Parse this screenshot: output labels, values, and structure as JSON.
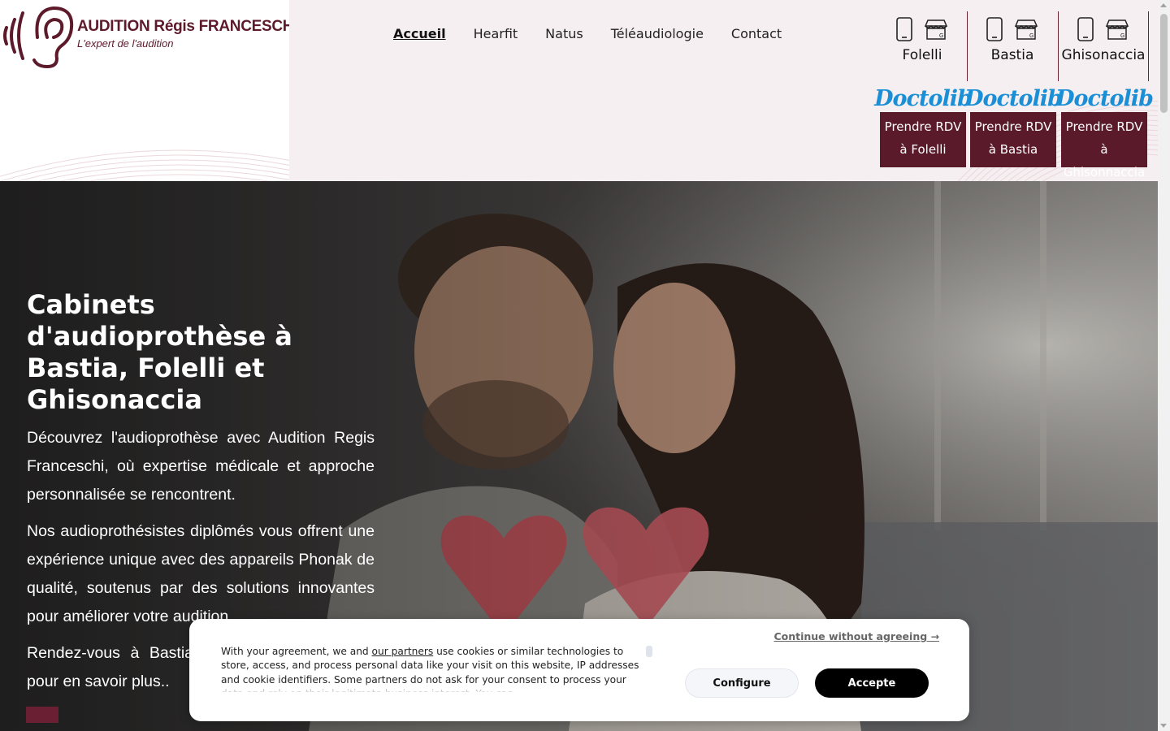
{
  "brand": {
    "title": "AUDITION Régis FRANCESCHI",
    "subtitle": "L'expert de l'audition",
    "color": "#5d1a2b"
  },
  "nav": {
    "items": [
      "Accueil",
      "Hearfit",
      "Natus",
      "Téléaudiologie",
      "Contact"
    ],
    "active": "Accueil"
  },
  "locations": [
    {
      "name": "Folelli",
      "doctolib": "Doctolib",
      "rdv": "Prendre RDV à Folelli"
    },
    {
      "name": "Bastia",
      "doctolib": "Doctolib",
      "rdv": "Prendre RDV à Bastia"
    },
    {
      "name": "Ghisonaccia",
      "doctolib": "Doctolib",
      "rdv": "Prendre RDV à Ghisonnaccia"
    }
  ],
  "icons": {
    "phone": "smartphone-icon",
    "store": "store-icon"
  },
  "hero": {
    "title": "Cabinets d'audioprothèse à Bastia, Folelli et Ghisonaccia",
    "p1": "Découvrez l'audioprothèse avec Audition Regis Franceschi, où expertise médicale et approche personnalisée se rencontrent.",
    "p2": "Nos audioprothésistes diplômés vous offrent une expérience unique avec des appareils Phonak de qualité, soutenus par des solutions innovantes pour améliorer votre audition.",
    "p3": "Rendez-vous à Bastia, Folelli ou Ghisonaccia pour en savoir plus.."
  },
  "cookie": {
    "text_before": "With your agreement, we and ",
    "partners_link": "our partners",
    "text_after": " use cookies or similar technologies to store, access, and process personal data like your visit on this website, IP addresses and cookie identifiers. Some partners do not ask for your consent to process your data and rely on their legitimate business interest. You can",
    "continue": "Continue without agreeing →",
    "configure": "Configure",
    "accept": "Accepte"
  },
  "colors": {
    "accent": "#5b1a2a",
    "doctolib": "#1a8fd6",
    "header_bg": "#f6eff1"
  }
}
